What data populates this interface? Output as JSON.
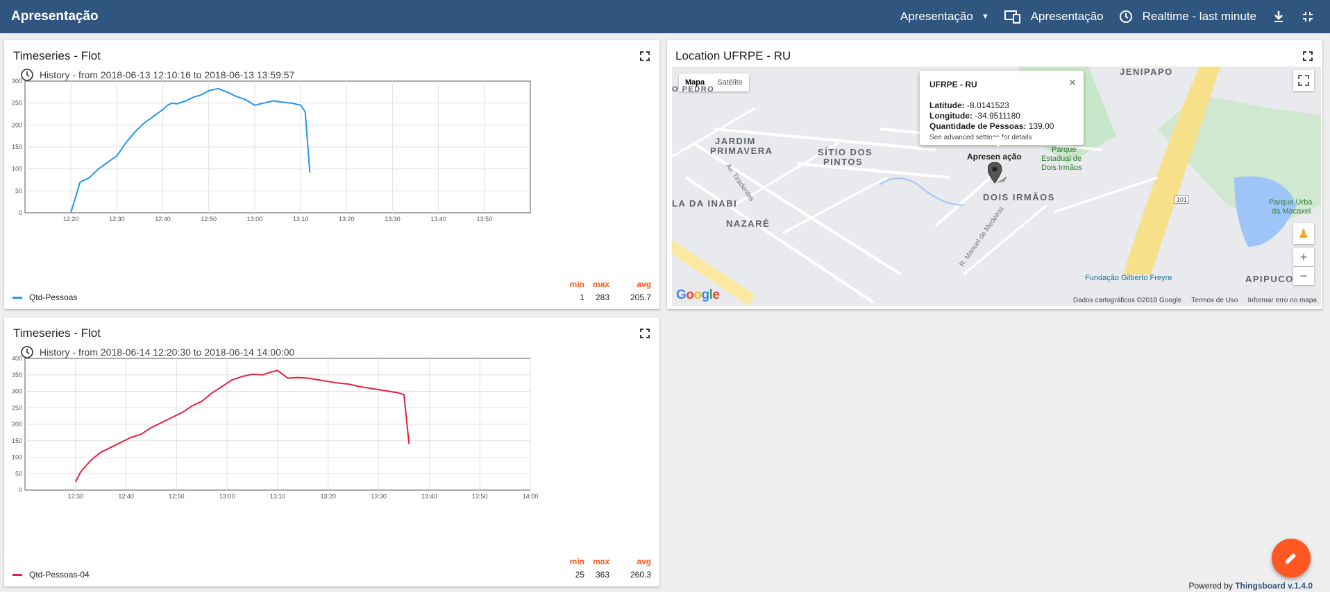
{
  "topbar": {
    "title": "Apresentação",
    "dashboard_select": "Apresentação",
    "state_label": "Apresentação",
    "timewindow_label": "Realtime - last minute"
  },
  "widgets": [
    {
      "title": "Timeseries - Flot",
      "history": "History - from 2018-06-13 12:10:16 to 2018-06-13 13:59:57",
      "legend": {
        "headers": {
          "min": "min",
          "max": "max",
          "avg": "avg"
        },
        "label": "Qtd-Pessoas",
        "min": "1",
        "max": "283",
        "avg": "205.7",
        "color": "#2196f3"
      }
    },
    {
      "title": "Timeseries - Flot",
      "history": "History - from 2018-06-14 12:20:30 to 2018-06-14 14:00:00",
      "legend": {
        "headers": {
          "min": "min",
          "max": "max",
          "avg": "avg"
        },
        "label": "Qtd-Pessoas-04",
        "min": "25",
        "max": "363",
        "avg": "260.3",
        "color": "#e91e3a"
      }
    }
  ],
  "map_widget": {
    "title": "Location UFRPE - RU",
    "map_type": [
      "Mapa",
      "Satélite"
    ],
    "infowindow": {
      "title": "UFRPE - RU",
      "lat_label": "Latitude:",
      "lat_value": "-8.0141523",
      "lon_label": "Longitude:",
      "lon_value": "-34.9511180",
      "qty_label": "Quantidade de Pessoas:",
      "qty_value": "139.00",
      "note": "See advanced settings for details"
    },
    "marker_label": "Apresen ação",
    "places": {
      "jardim": "JARDIM",
      "primavera": "PRIMAVERA",
      "sitio": "SÍTIO DOS",
      "pintos": "PINTOS",
      "dois_irmaos": "DOIS IRMÃOS",
      "nazare": "NAZARÉ",
      "inabi": "LA DA INABI",
      "apipucos": "APIPUCOS",
      "jenipapo": "JENIPAPO",
      "pedro": "O PEDRO",
      "parque1": "Parque",
      "parque2": "Estadual de",
      "parque3": "Dois Irmãos",
      "parque_urba": "Parque Urba",
      "macaxe": "da Macaxei",
      "fundacao": "Fundação Gilberto Freyre",
      "tiradentes": "Av. Tiradentes",
      "medeiros": "R. Manuel de Medeiros",
      "rodovia": "101"
    },
    "footer": {
      "data": "Dados cartográficos ©2018 Google",
      "terms": "Termos de Uso",
      "report": "Informar erro no mapa"
    },
    "google": "Google"
  },
  "footer": {
    "powered_by": "Powered by",
    "brand": "Thingsboard v.1.4.0"
  },
  "chart_data": [
    {
      "type": "line",
      "title": "Timeseries - Flot",
      "series": [
        {
          "name": "Qtd-Pessoas",
          "color": "#2196f3",
          "x": [
            "12:20",
            "12:22",
            "12:24",
            "12:26",
            "12:28",
            "12:30",
            "12:32",
            "12:34",
            "12:36",
            "12:38",
            "12:40",
            "12:41",
            "12:42",
            "12:43",
            "12:45",
            "12:47",
            "12:48",
            "12:50",
            "12:52",
            "12:54",
            "12:56",
            "12:58",
            "13:00",
            "13:02",
            "13:04",
            "13:06",
            "13:08",
            "13:10",
            "13:11",
            "13:12"
          ],
          "values": [
            1,
            70,
            80,
            100,
            115,
            130,
            160,
            185,
            205,
            220,
            235,
            245,
            250,
            248,
            255,
            265,
            267,
            278,
            283,
            275,
            265,
            258,
            245,
            250,
            255,
            252,
            250,
            245,
            230,
            92
          ]
        }
      ],
      "ylim": [
        0,
        300
      ],
      "y_ticks": [
        0,
        50,
        100,
        150,
        200,
        250,
        300
      ],
      "x_ticks": [
        "12:20",
        "12:30",
        "12:40",
        "12:50",
        "13:00",
        "13:10",
        "13:20",
        "13:30",
        "13:40",
        "13:50"
      ]
    },
    {
      "type": "line",
      "title": "Timeseries - Flot",
      "series": [
        {
          "name": "Qtd-Pessoas-04",
          "color": "#e91e3a",
          "x": [
            "12:30",
            "12:31",
            "12:33",
            "12:35",
            "12:37",
            "12:39",
            "12:41",
            "12:43",
            "12:45",
            "12:47",
            "12:49",
            "12:51",
            "12:53",
            "12:55",
            "12:57",
            "12:59",
            "13:01",
            "13:03",
            "13:05",
            "13:07",
            "13:09",
            "13:10",
            "13:12",
            "13:14",
            "13:16",
            "13:18",
            "13:20",
            "13:22",
            "13:24",
            "13:26",
            "13:28",
            "13:30",
            "13:32",
            "13:34",
            "13:35",
            "13:36"
          ],
          "values": [
            25,
            55,
            90,
            115,
            130,
            145,
            160,
            170,
            190,
            205,
            220,
            235,
            255,
            270,
            295,
            315,
            335,
            345,
            352,
            350,
            360,
            363,
            340,
            342,
            340,
            335,
            330,
            325,
            322,
            315,
            310,
            305,
            300,
            295,
            290,
            140
          ]
        }
      ],
      "ylim": [
        0,
        400
      ],
      "y_ticks": [
        0,
        50,
        100,
        150,
        200,
        250,
        300,
        350,
        400
      ],
      "x_ticks": [
        "12:30",
        "12:40",
        "12:50",
        "13:00",
        "13:10",
        "13:20",
        "13:30",
        "13:40",
        "13:50",
        "14:00"
      ]
    }
  ]
}
